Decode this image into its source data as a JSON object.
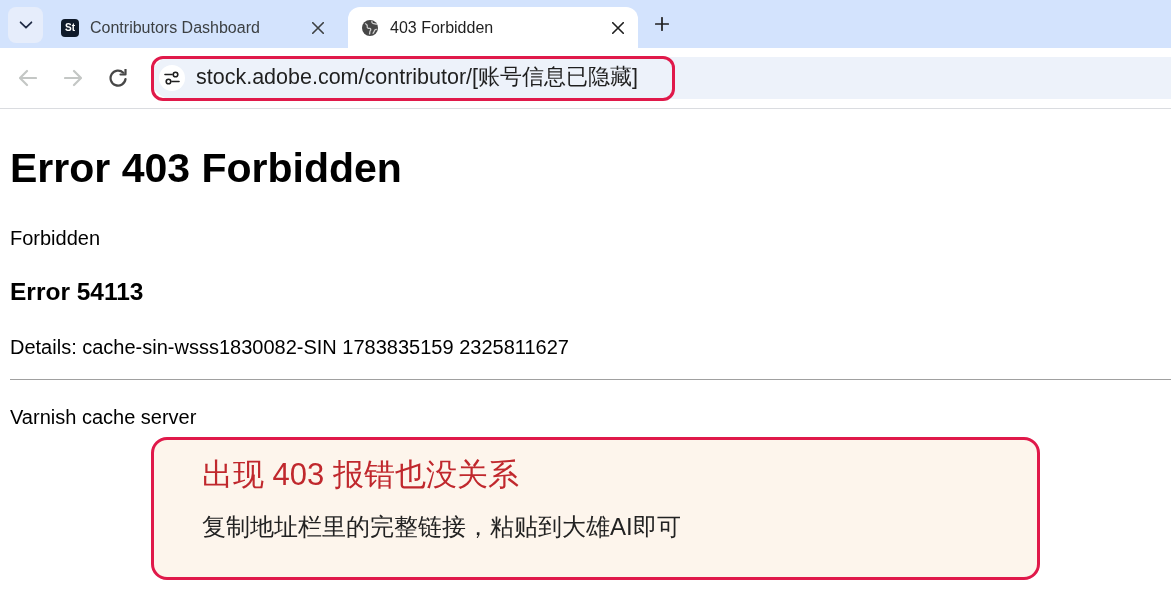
{
  "tab_strip": {
    "tabs": [
      {
        "title": "Contributors Dashboard",
        "favicon_text": "St",
        "selected": false
      },
      {
        "title": "403 Forbidden",
        "selected": true
      }
    ]
  },
  "toolbar": {
    "buttons": [
      {
        "kind": "back",
        "disabled": true
      },
      {
        "kind": "forward",
        "disabled": true
      },
      {
        "kind": "reload",
        "disabled": false
      }
    ],
    "address_bar": {
      "url": "stock.adobe.com/contributor/[账号信息已隐藏]",
      "highlighted": true
    }
  },
  "page": {
    "title": "Error 403 Forbidden",
    "message": "Forbidden",
    "error_code": "Error 54113",
    "details": "Details: cache-sin-wsss1830082-SIN 1783835159 2325811627",
    "footer": "Varnish cache server"
  },
  "callout": {
    "title": "出现 403 报错也没关系",
    "text": "复制地址栏里的完整链接，粘贴到大雄AI即可"
  }
}
